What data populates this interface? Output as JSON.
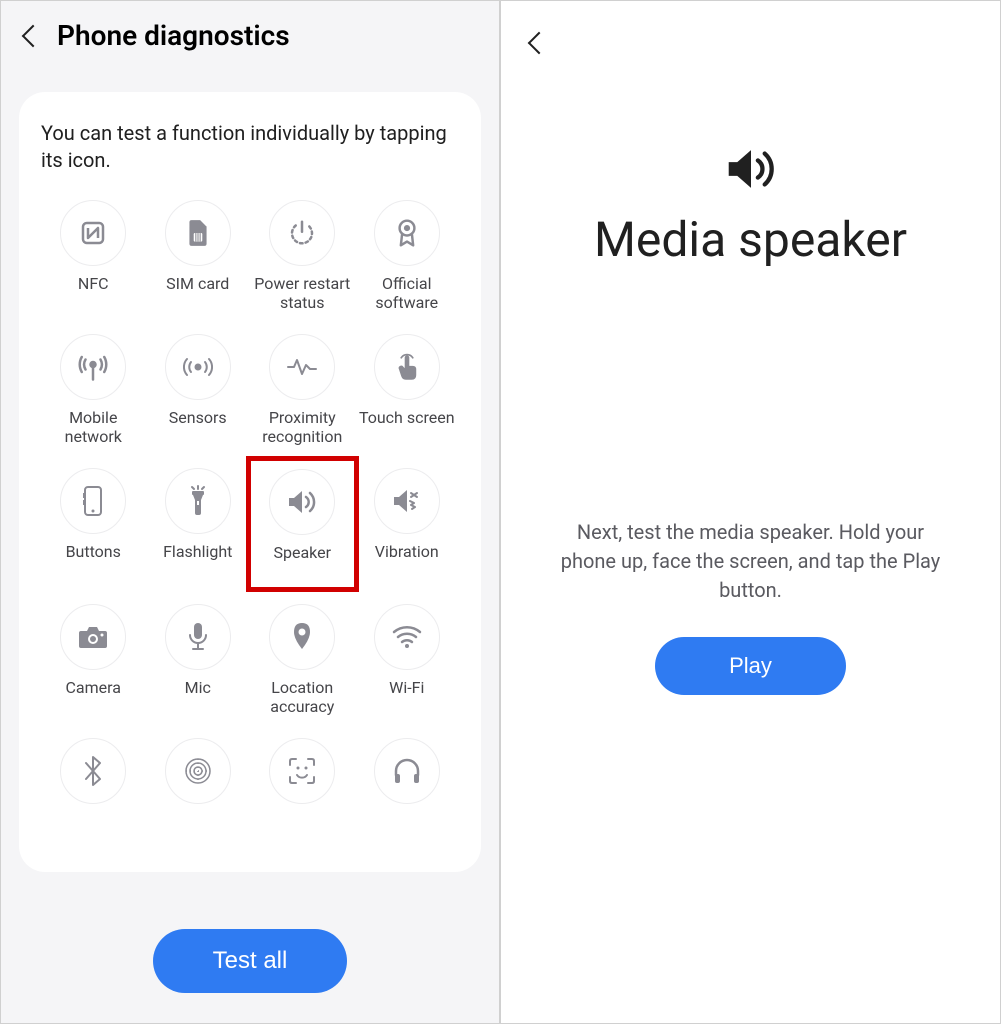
{
  "left": {
    "title": "Phone diagnostics",
    "intro": "You can test a function individually by tapping its icon.",
    "tiles": [
      {
        "icon": "nfc",
        "label": "NFC"
      },
      {
        "icon": "sim",
        "label": "SIM card"
      },
      {
        "icon": "power",
        "label": "Power restart status"
      },
      {
        "icon": "badge",
        "label": "Official software"
      },
      {
        "icon": "antenna",
        "label": "Mobile network"
      },
      {
        "icon": "sensors",
        "label": "Sensors"
      },
      {
        "icon": "proximity",
        "label": "Proximity recognition"
      },
      {
        "icon": "touch",
        "label": "Touch screen"
      },
      {
        "icon": "buttons",
        "label": "Buttons"
      },
      {
        "icon": "flashlight",
        "label": "Flashlight"
      },
      {
        "icon": "speaker",
        "label": "Speaker",
        "highlighted": true
      },
      {
        "icon": "vibration",
        "label": "Vibration"
      },
      {
        "icon": "camera",
        "label": "Camera"
      },
      {
        "icon": "mic",
        "label": "Mic"
      },
      {
        "icon": "location",
        "label": "Location accuracy"
      },
      {
        "icon": "wifi",
        "label": "Wi-Fi"
      },
      {
        "icon": "bluetooth",
        "label": ""
      },
      {
        "icon": "fingerprint",
        "label": ""
      },
      {
        "icon": "face",
        "label": ""
      },
      {
        "icon": "headphone",
        "label": ""
      }
    ],
    "test_all": "Test all"
  },
  "right": {
    "title": "Media speaker",
    "instructions": "Next, test the media speaker.\nHold your phone up, face the screen, and tap the Play button.",
    "play": "Play"
  },
  "annotations": {
    "highlight_color": "#d10000",
    "arrow_color": "#d10000"
  }
}
